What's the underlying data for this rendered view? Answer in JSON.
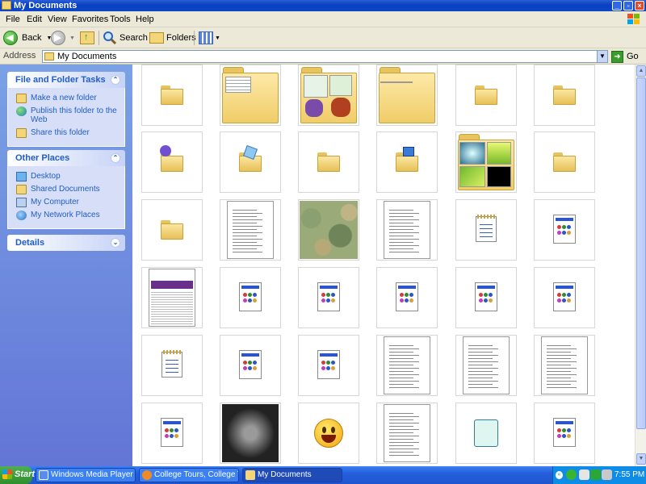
{
  "window": {
    "title": "My Documents"
  },
  "menu": [
    "File",
    "Edit",
    "View",
    "Favorites",
    "Tools",
    "Help"
  ],
  "toolbar": {
    "back": "Back",
    "search": "Search",
    "folders": "Folders"
  },
  "address": {
    "label": "Address",
    "value": "My Documents",
    "go": "Go"
  },
  "left_pane": {
    "file_tasks": {
      "title": "File and Folder Tasks",
      "items": [
        "Make a new folder",
        "Publish this folder to the Web",
        "Share this folder"
      ]
    },
    "other_places": {
      "title": "Other Places",
      "items": [
        "Desktop",
        "Shared Documents",
        "My Computer",
        "My Network Places"
      ]
    },
    "details": {
      "title": "Details"
    }
  },
  "thumbnails": [
    [
      "folder",
      "folder-table",
      "folder-images",
      "folder-note",
      "folder",
      "folder"
    ],
    [
      "music-folder",
      "picture-folder",
      "folder",
      "video-folder",
      "folder-photos",
      "folder"
    ],
    [
      "folder",
      "document-page",
      "camo-image",
      "document-page",
      "notepad",
      "html-doc"
    ],
    [
      "spreadsheet-image",
      "html-doc",
      "html-doc",
      "html-doc",
      "html-doc",
      "html-doc"
    ],
    [
      "notepad",
      "html-doc",
      "html-doc",
      "document-page",
      "document-page",
      "document-page"
    ],
    [
      "html-doc",
      "xray-image",
      "smiley",
      "document-page",
      "scroll-doc",
      "html-doc"
    ]
  ],
  "taskbar": {
    "start": "Start",
    "tasks": [
      "Windows Media Player",
      "College Tours, College Tri...",
      "My Documents"
    ],
    "clock": "7:55 PM"
  },
  "colors": {
    "title_bar": "#0a3fbf",
    "side_pane": "#6375d6",
    "link": "#215dc6",
    "taskbar": "#245edb",
    "start": "#2f8f2f"
  }
}
